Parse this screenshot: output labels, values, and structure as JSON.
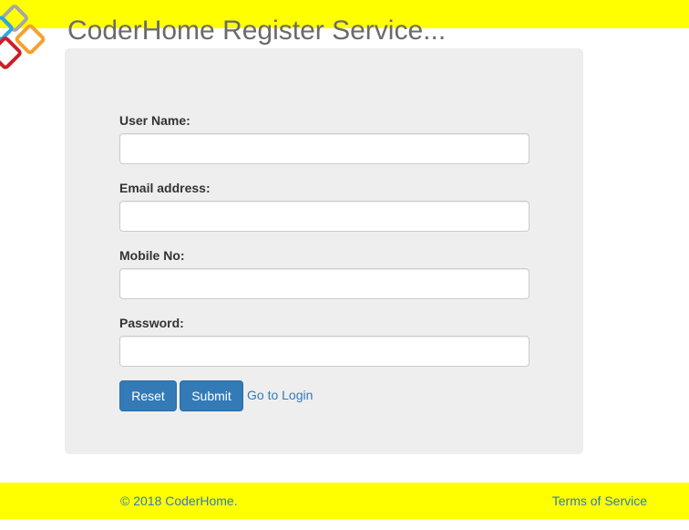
{
  "header": {
    "title": "CoderHome Register Service..."
  },
  "form": {
    "username_label": "User Name:",
    "username_value": "",
    "email_label": "Email address:",
    "email_value": "",
    "mobile_label": "Mobile No:",
    "mobile_value": "",
    "password_label": "Password:",
    "password_value": "",
    "reset_label": "Reset",
    "submit_label": "Submit",
    "login_link": "Go to Login"
  },
  "footer": {
    "copyright": "© 2018 CoderHome.",
    "terms": "Terms of Service"
  },
  "colors": {
    "bar": "#ffff00",
    "panel": "#eeeeee",
    "primary": "#337ab7",
    "title": "#6b6b6b"
  },
  "icons": {
    "logo": "colored-squares-logo"
  }
}
